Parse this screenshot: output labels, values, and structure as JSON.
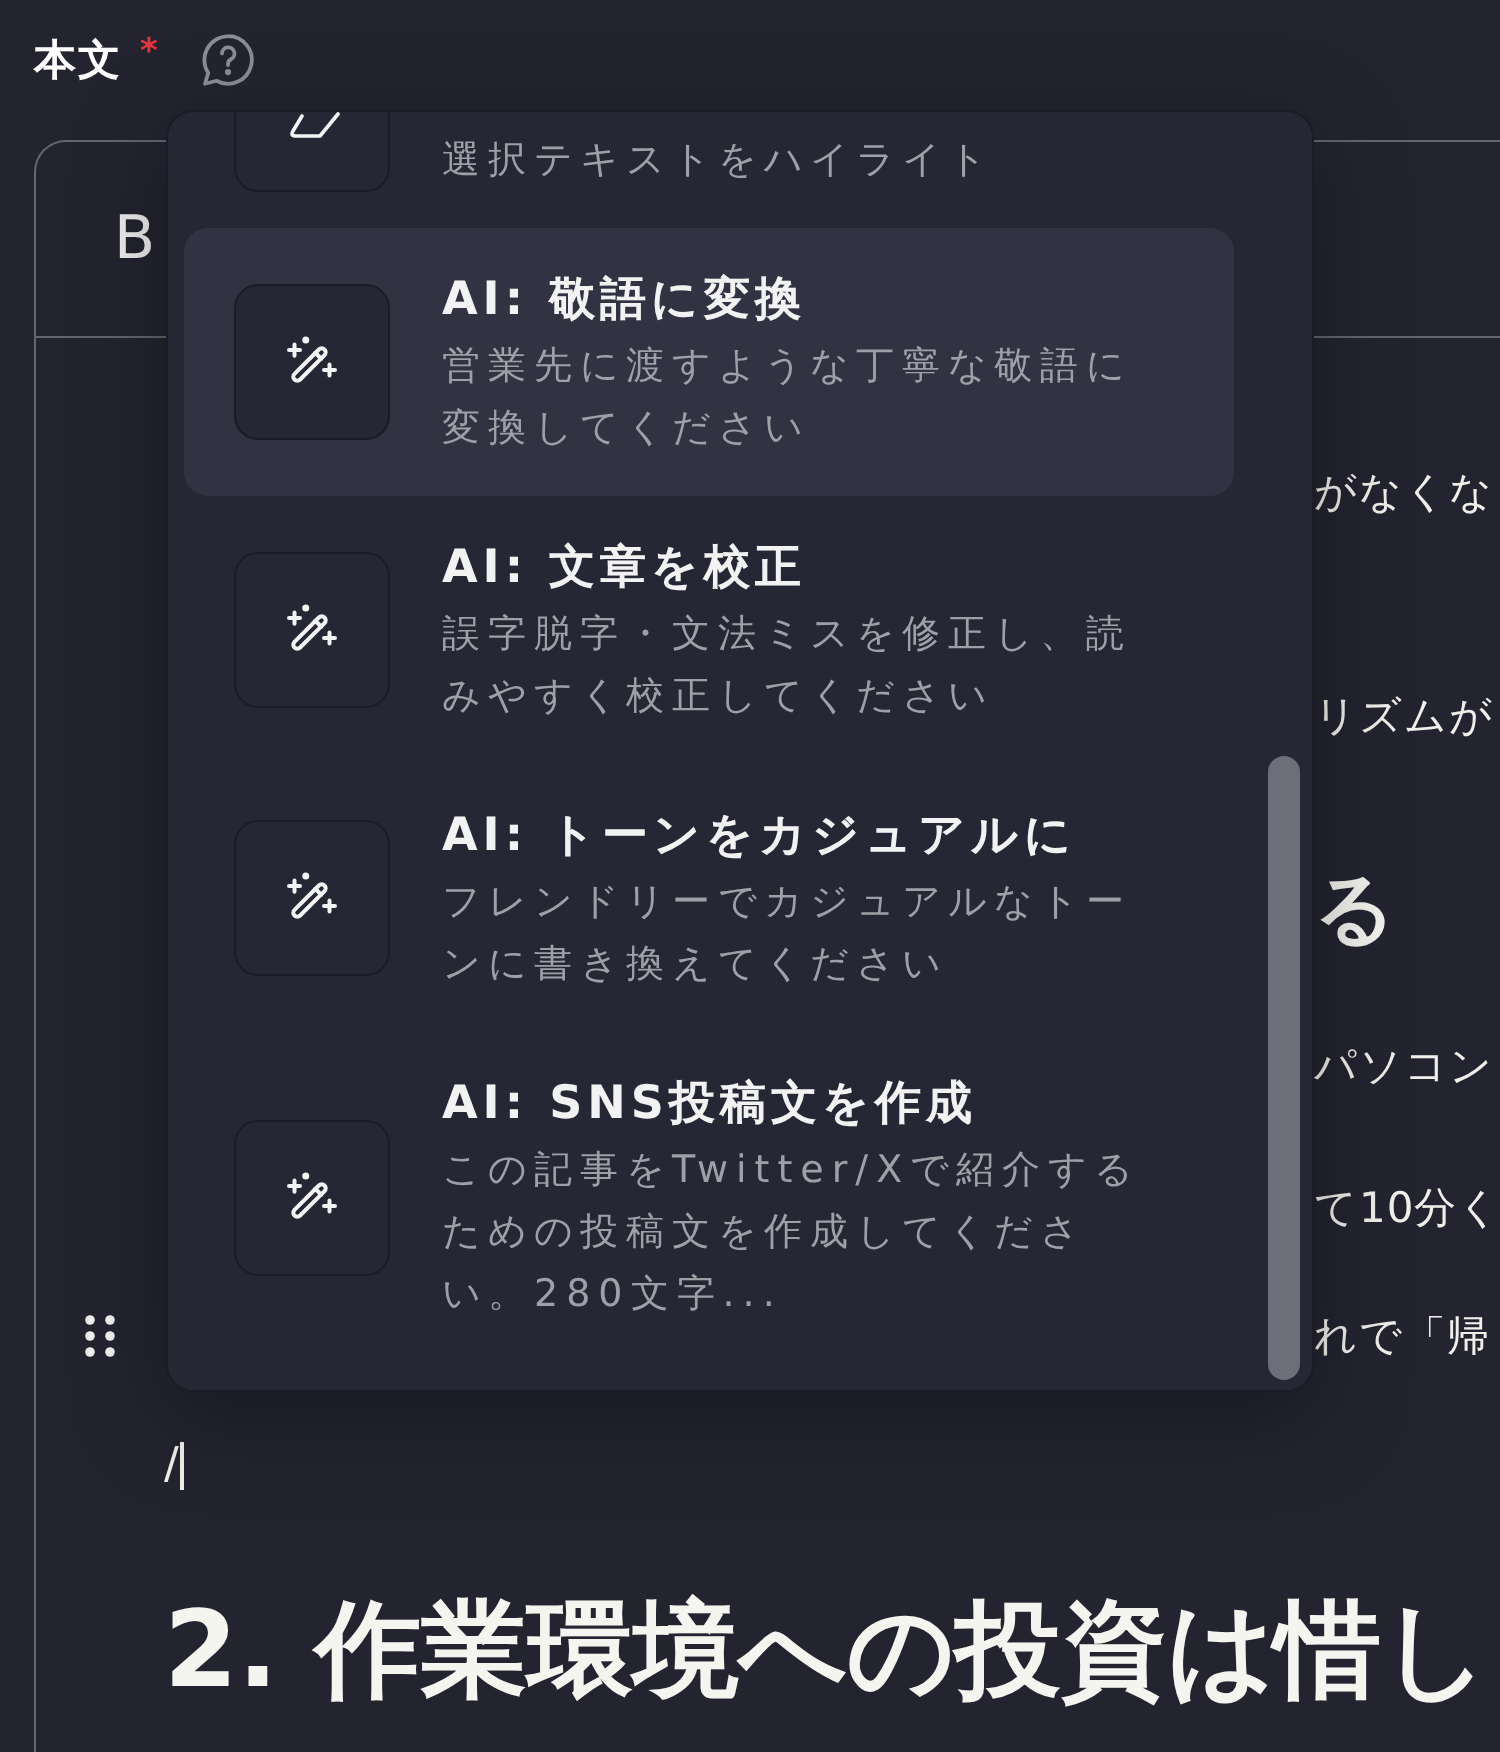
{
  "field": {
    "label": "本文",
    "required_mark": "*"
  },
  "editor": {
    "toolbar": [
      {
        "kind": "bold",
        "label": "B"
      }
    ],
    "lines": [
      {
        "kind": "paragraph",
        "text": "がなくな",
        "handle": false
      },
      {
        "kind": "paragraph",
        "text": "リズムが",
        "handle": false
      },
      {
        "kind": "subheading",
        "text": "る",
        "handle": false
      },
      {
        "kind": "paragraph",
        "text": "パソコン",
        "handle": false
      },
      {
        "kind": "paragraph",
        "text": "て10分く",
        "handle": false
      },
      {
        "kind": "paragraph",
        "text": "れで「帰",
        "handle": true
      },
      {
        "kind": "command",
        "text": "/",
        "handle": false
      },
      {
        "kind": "heading",
        "text": "2. 作業環境への投資は惜し",
        "handle": false
      }
    ]
  },
  "command_menu": {
    "items": [
      {
        "kind": "format",
        "description": "選択テキストをハイライト",
        "selected": false
      },
      {
        "kind": "ai",
        "title": "AI: 敬語に変換",
        "description": "営業先に渡すような丁寧な敬語に変換してください",
        "selected": true
      },
      {
        "kind": "ai",
        "title": "AI: 文章を校正",
        "description": "誤字脱字・文法ミスを修正し、読みやすく校正してください",
        "selected": false
      },
      {
        "kind": "ai",
        "title": "AI: トーンをカジュアルに",
        "description": "フレンドリーでカジュアルなトーンに書き換えてください",
        "selected": false
      },
      {
        "kind": "ai",
        "title": "AI: SNS投稿文を作成",
        "description": "この記事をTwitter/Xで紹介するための投稿文を作成してください。280文字...",
        "selected": false
      }
    ]
  }
}
